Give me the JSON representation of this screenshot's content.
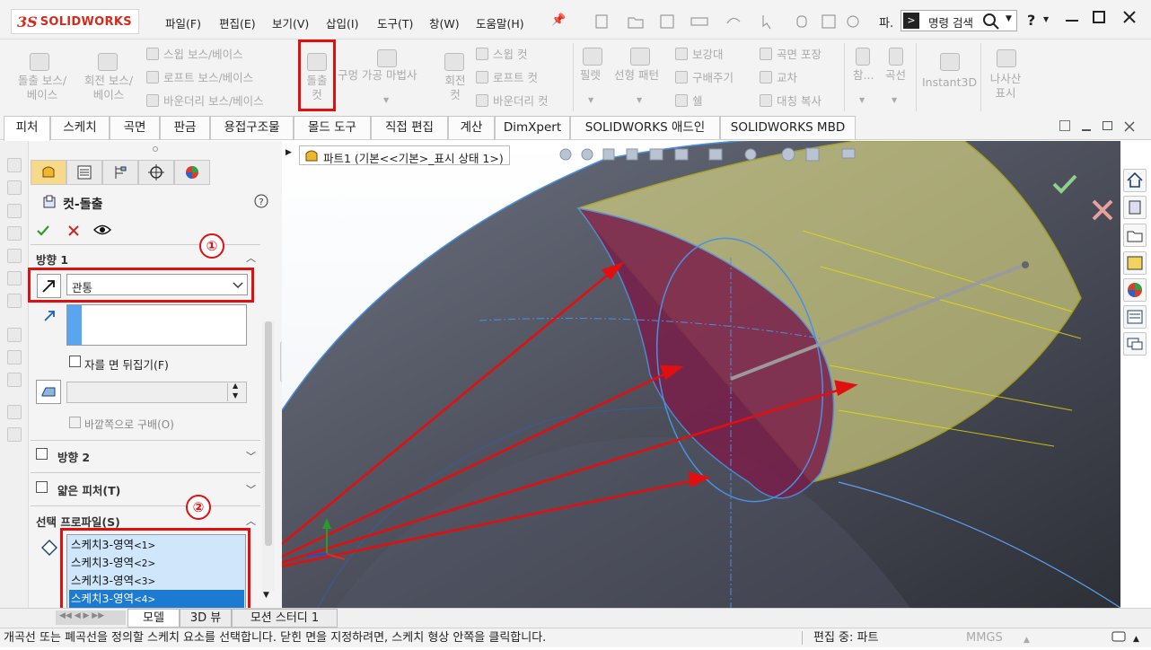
{
  "brand": {
    "ds": "3S",
    "name": "SOLIDWORKS"
  },
  "menu": [
    "파일(F)",
    "편집(E)",
    "보기(V)",
    "삽입(I)",
    "도구(T)",
    "창(W)",
    "도움말(H)"
  ],
  "search": {
    "label": "명령 검색"
  },
  "toolbar_misc": {
    "pa": "파.",
    "help": "?"
  },
  "ribbon": {
    "extrude_boss": "돌출 보스/\n베이스",
    "revolve_boss": "회전 보스/\n베이스",
    "sweep_boss": "스윕 보스/베이스",
    "loft_boss": "로프트 보스/베이스",
    "boundary_boss": "바운더리 보스/베이스",
    "extruded_cut": "돌출\n컷",
    "hole_wizard": "구멍 가공 마법사",
    "revolve_cut": "회전\n컷",
    "sweep_cut": "스윕 컷",
    "loft_cut": "로프트 컷",
    "boundary_cut": "바운더리 컷",
    "fillet": "필렛",
    "linear_pattern": "선형 패턴",
    "rib": "보강대",
    "draft": "구배주기",
    "shell": "쉘",
    "wrap": "곡면 포장",
    "intersect": "교차",
    "mirror": "대칭 복사",
    "ref": "참...",
    "curves": "곡선",
    "instant3d": "Instant3D",
    "helix": "나사산\n표시"
  },
  "tabs": [
    "피처",
    "스케치",
    "곡면",
    "판금",
    "용접구조물",
    "몰드 도구",
    "직접 편집",
    "계산",
    "DimXpert",
    "SOLIDWORKS 애드인",
    "SOLIDWORKS MBD"
  ],
  "active_tab": "피처",
  "breadcrumb": "파트1  (기본<<기본>_표시 상태 1>)",
  "pm": {
    "title": "컷-돌출",
    "direction1": "방향 1",
    "end_condition": "관통",
    "flip_side": "자를 면 뒤집기(F)",
    "draft_outward": "바깥쪽으로 구배(O)",
    "direction2": "방향 2",
    "thin_feature": "얇은 피처(T)",
    "selected_profiles": "선택 프로파일(S)",
    "profiles": [
      {
        "name": "스케치3-영역",
        "idx": "<1>"
      },
      {
        "name": "스케치3-영역",
        "idx": "<2>"
      },
      {
        "name": "스케치3-영역",
        "idx": "<3>"
      },
      {
        "name": "스케치3-영역",
        "idx": "<4>"
      }
    ],
    "selected_index": 3
  },
  "annotations": {
    "one": "①",
    "two": "②"
  },
  "bottom_tabs": [
    "모델",
    "3D 뷰",
    "모션 스터디 1"
  ],
  "status": {
    "message": "개곡선 또는 폐곡선을 정의할 스케치 요소를 선택합니다. 닫힌 면을 지정하려면, 스케치 형상 안쪽을 클릭합니다.",
    "editing": "편집 중: 파트",
    "units": "MMGS"
  },
  "colors": {
    "annotation": "#e01010",
    "selection": "#1c7ad2",
    "brand": "#d52b1e"
  }
}
